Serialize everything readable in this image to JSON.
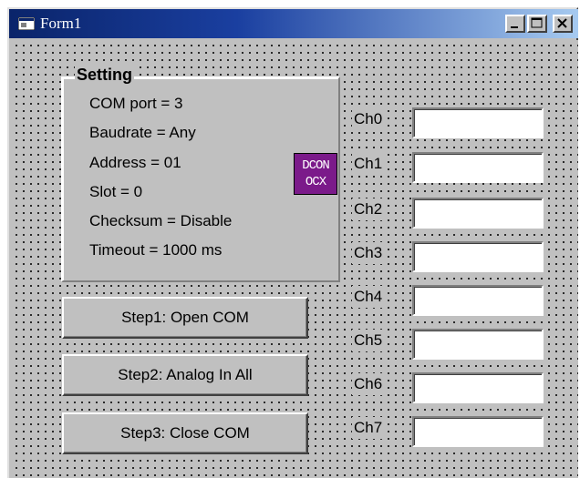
{
  "window": {
    "title": "Form1",
    "controls": {
      "minimize": "minimize",
      "maximize": "maximize",
      "close": "close"
    }
  },
  "setting": {
    "caption": "Setting",
    "lines": [
      "COM port = 3",
      "Baudrate = Any",
      "Address = 01",
      "Slot = 0",
      "Checksum = Disable",
      "Timeout = 1000 ms"
    ]
  },
  "ocx": {
    "line1": "DCON",
    "line2": "OCX",
    "color": "#7b1a8a"
  },
  "buttons": {
    "step1": "Step1: Open COM",
    "step2": "Step2: Analog In All",
    "step3": "Step3: Close COM"
  },
  "channels": [
    {
      "label": "Ch0",
      "value": ""
    },
    {
      "label": "Ch1",
      "value": ""
    },
    {
      "label": "Ch2",
      "value": ""
    },
    {
      "label": "Ch3",
      "value": ""
    },
    {
      "label": "Ch4",
      "value": ""
    },
    {
      "label": "Ch5",
      "value": ""
    },
    {
      "label": "Ch6",
      "value": ""
    },
    {
      "label": "Ch7",
      "value": ""
    }
  ],
  "colors": {
    "titlebar_start": "#0a246a",
    "titlebar_end": "#a6caf0",
    "face": "#c0c0c0"
  }
}
